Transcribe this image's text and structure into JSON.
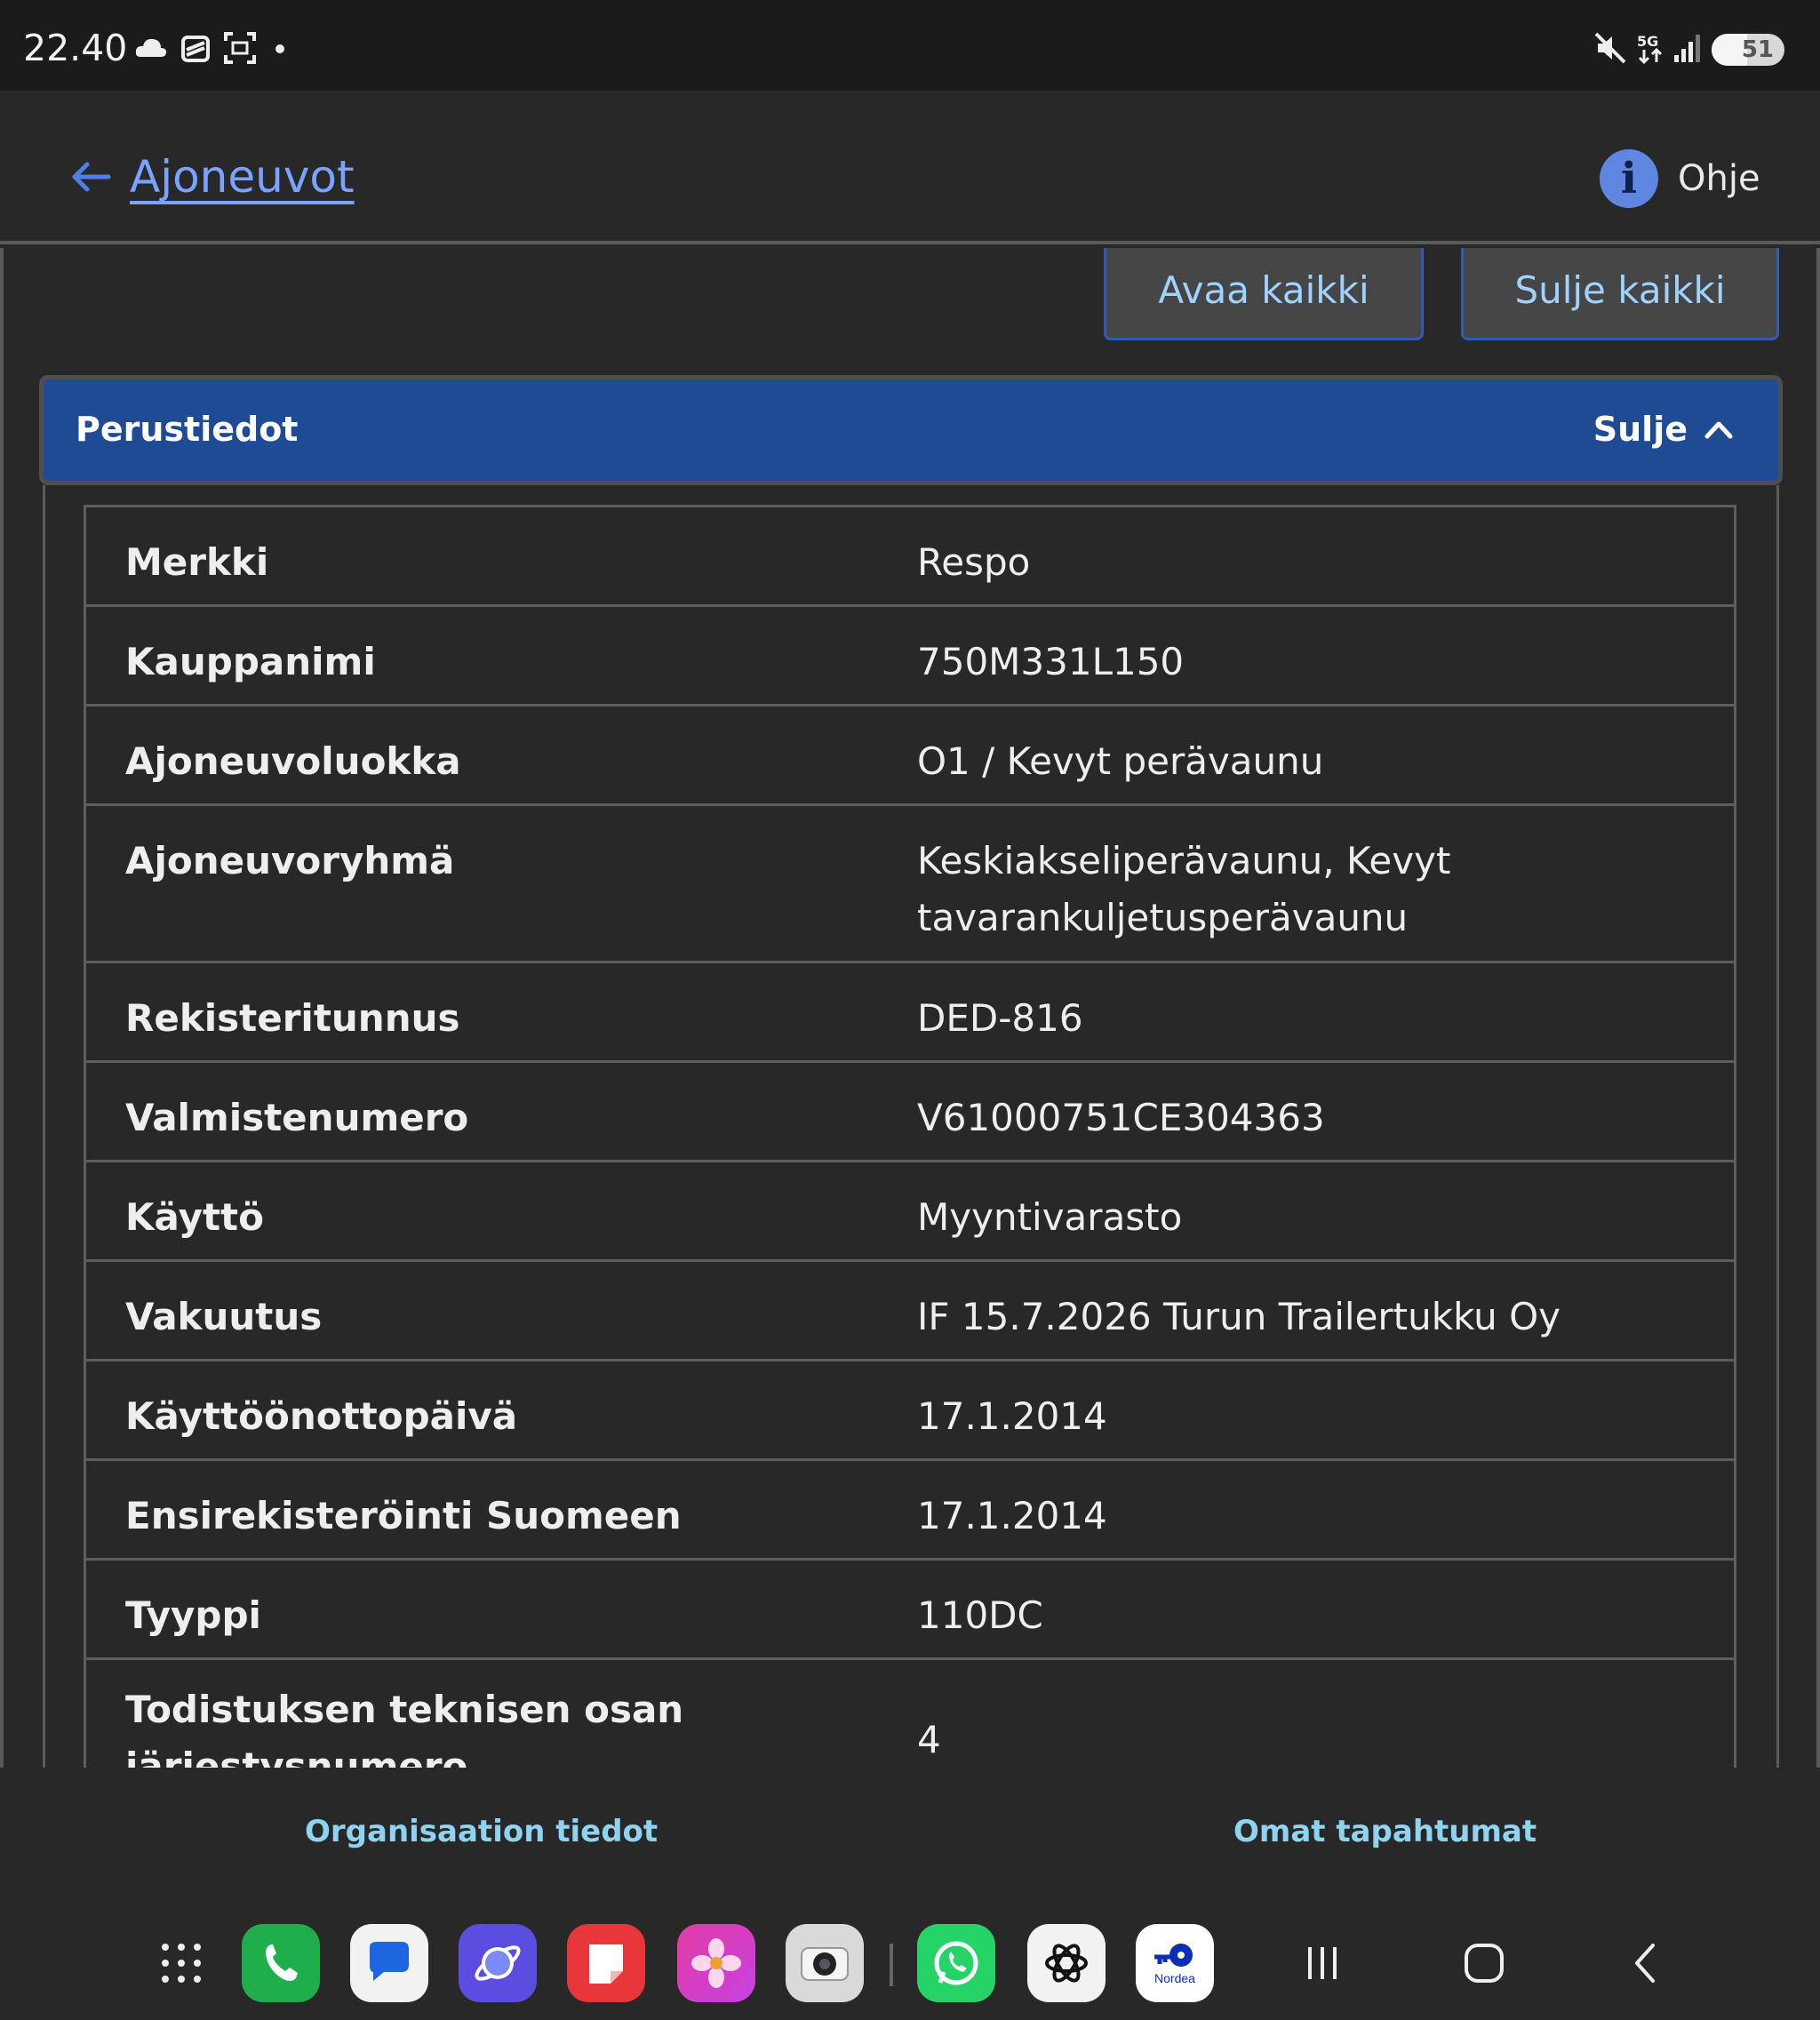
{
  "status_bar": {
    "time": "22.40",
    "battery": "51",
    "icons_left": [
      "cloud-icon",
      "stack-icon",
      "screenshot-icon"
    ],
    "icons_right": [
      "mute-icon",
      "5g-icon",
      "signal-icon"
    ]
  },
  "header": {
    "back_label": "Ajoneuvot",
    "help_label": "Ohje",
    "help_glyph": "i"
  },
  "actions": {
    "open_all": "Avaa kaikki",
    "close_all": "Sulje kaikki"
  },
  "section": {
    "title": "Perustiedot",
    "toggle_label": "Sulje",
    "rows": [
      {
        "label": "Merkki",
        "value": "Respo"
      },
      {
        "label": "Kauppanimi",
        "value": "750M331L150"
      },
      {
        "label": "Ajoneuvoluokka",
        "value": "O1 / Kevyt perävaunu"
      },
      {
        "label": "Ajoneuvoryhmä",
        "value": "Keskiakseliperävaunu, Kevyt tavarankuljetusperävaunu"
      },
      {
        "label": "Rekisteritunnus",
        "value": "DED-816"
      },
      {
        "label": "Valmistenumero",
        "value": "V61000751CE304363"
      },
      {
        "label": "Käyttö",
        "value": "Myyntivarasto"
      },
      {
        "label": "Vakuutus",
        "value": "IF 15.7.2026 Turun Trailertukku Oy"
      },
      {
        "label": "Käyttöönottopäivä",
        "value": "17.1.2014"
      },
      {
        "label": "Ensirekisteröinti Suomeen",
        "value": "17.1.2014"
      },
      {
        "label": "Tyyppi",
        "value": "110DC"
      },
      {
        "label": "Todistuksen teknisen osan järjestysnumero",
        "value": "4"
      }
    ]
  },
  "bottom_nav": {
    "org_label": "Organisaation tiedot",
    "events_label": "Omat tapahtumat"
  },
  "taskbar": {
    "apps": [
      "phone-app",
      "messages-app",
      "internet-app",
      "notes-app",
      "gallery-app",
      "camera-app",
      "whatsapp-app",
      "chatgpt-app",
      "nordea-app"
    ],
    "nordea_label": "Nordea"
  },
  "colors": {
    "accent_blue": "#1f4b94",
    "link_blue": "#7aa3ff",
    "button_text": "#9fd3ff",
    "nav_text": "#8ed3f0"
  }
}
